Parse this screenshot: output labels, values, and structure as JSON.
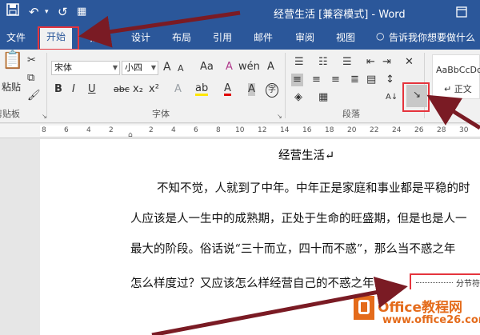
{
  "window": {
    "title": "经营生活 [兼容模式] - Word",
    "restore_icon": "restore-window-icon"
  },
  "qat": {
    "save_icon": "save-icon",
    "undo_icon": "undo-icon",
    "redo_icon": "redo-icon",
    "touch_icon": "touch-mode-icon"
  },
  "tabs": [
    "文件",
    "开始",
    "插入",
    "设计",
    "布局",
    "引用",
    "邮件",
    "审阅",
    "视图"
  ],
  "tell_me": "告诉我你想要做什么",
  "ribbon": {
    "clipboard": {
      "paste_label": "粘贴",
      "group_label": "剪贴板"
    },
    "font": {
      "font_name": "宋体",
      "font_size": "小四",
      "grow": "A",
      "shrink": "A",
      "case": "Aa",
      "clear": "A",
      "bold": "B",
      "italic": "I",
      "underline": "U",
      "strike": "abc",
      "sub": "x₂",
      "sup": "x²",
      "effects": "A",
      "highlight": "ab",
      "color": "A",
      "shade": "A",
      "phonetic": "A",
      "enclose": "字",
      "group_label": "字体"
    },
    "paragraph": {
      "group_label": "段落"
    },
    "styles": {
      "preview": "AaBbCcDc",
      "normal": "↵ 正文"
    }
  },
  "ruler_numbers": [
    "8",
    "6",
    "4",
    "2",
    "2",
    "4",
    "6",
    "8",
    "10",
    "12",
    "14",
    "16",
    "18",
    "20",
    "22",
    "24",
    "26",
    "28",
    "30"
  ],
  "document": {
    "title": "经营生活↵",
    "lines": [
      "不知不觉，人就到了中年。中年正是家庭和事业都是平稳的时",
      "人应该是人一生中的成熟期，正处于生命的旺盛期，但是也是人一",
      "最大的阶段。俗话说“三十而立，四十而不惑”，那么当不惑之年",
      "怎么样度过？又应该怎么样经营自己的不惑之年？"
    ],
    "section_break": "分节符"
  },
  "watermark": {
    "brand": "Office教程网",
    "url": "www.office26.com"
  },
  "colors": {
    "accent": "#2b579a",
    "highlight_box": "#e5343d",
    "arrow": "#7a1b24"
  }
}
